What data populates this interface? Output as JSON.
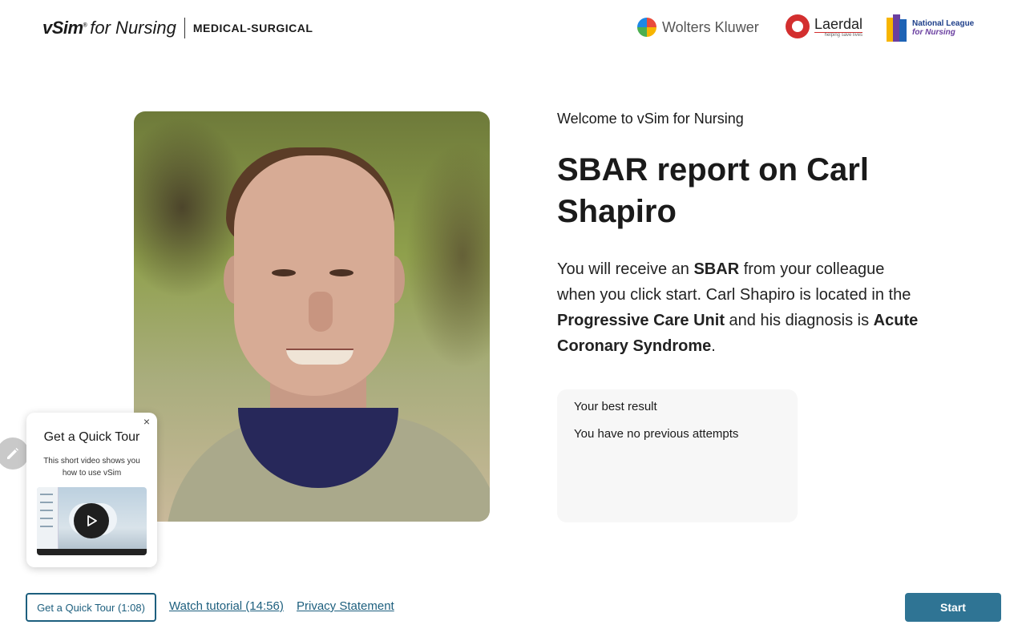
{
  "header": {
    "brand_vsim": "vSim",
    "brand_tm": "®",
    "brand_fornursing": "for Nursing",
    "product": "MEDICAL-SURGICAL",
    "logo_wk": "Wolters Kluwer",
    "logo_laerdal": "Laerdal",
    "logo_laerdal_tagline": "helping save lives",
    "logo_nln_line1": "National League",
    "logo_nln_line2": "for Nursing"
  },
  "main": {
    "welcome": "Welcome to vSim for Nursing",
    "title": "SBAR report on Carl Shapiro",
    "desc": {
      "p1": "You will receive an ",
      "b1": "SBAR",
      "p2": " from your colleague when you click start. Carl Shapiro is located in the ",
      "b2": "Progressive Care Unit",
      "p3": " and his diagnosis is ",
      "b3": "Acute Coronary Syndrome",
      "p4": "."
    }
  },
  "result": {
    "title": "Your best result",
    "value": "You have no previous attempts"
  },
  "tour_popup": {
    "close": "×",
    "title": "Get a Quick Tour",
    "desc": "This short video shows you how to use vSim"
  },
  "footer": {
    "tour_button": "Get a Quick Tour (1:08)",
    "tutorial_link": "Watch tutorial (14:56)",
    "privacy_link": "Privacy Statement",
    "start_button": "Start"
  },
  "icons": {
    "edit": "pencil-icon",
    "play": "play-icon",
    "close": "close-icon"
  },
  "colors": {
    "accent": "#1d5f7e",
    "start_button": "#2f7494",
    "card_bg": "#f7f7f7"
  }
}
